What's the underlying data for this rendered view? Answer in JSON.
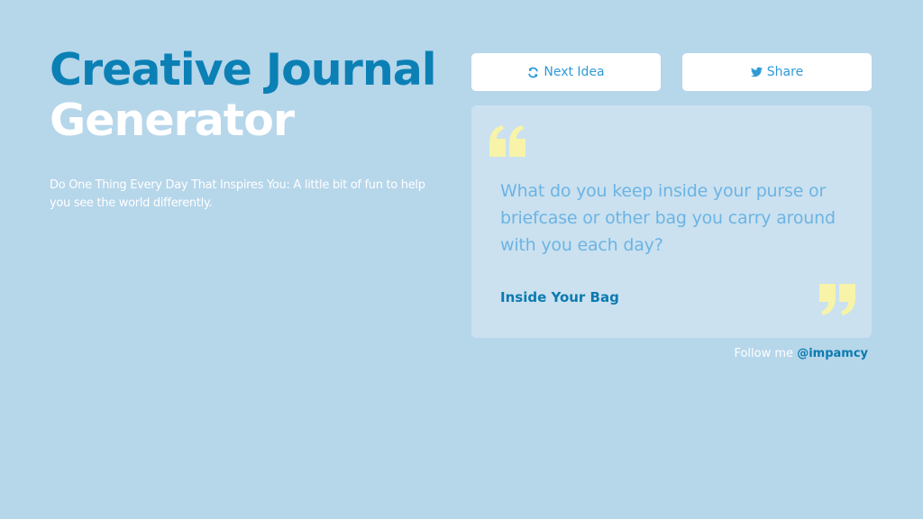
{
  "header": {
    "title_line1": "Creative Journal",
    "title_line2": "Generator",
    "subtitle": "Do One Thing Every Day That Inspires You: A little bit of fun to help you see the world differently."
  },
  "actions": {
    "next_label": "Next Idea",
    "next_icon": "refresh-icon",
    "share_label": "Share",
    "share_icon": "twitter-icon"
  },
  "card": {
    "prompt": "What do you keep inside your purse or briefcase or other bag you carry around with you each day?",
    "prompt_title": "Inside Your Bag",
    "quote_open_icon": "quote-open-icon",
    "quote_close_icon": "quote-close-icon"
  },
  "footer": {
    "follow_text": "Follow me",
    "follow_handle": "@impamcy"
  },
  "colors": {
    "background": "#b6d6ea",
    "accent": "#0b80b5",
    "card": "#cbe1ef",
    "quote_marks": "#f7f3a8",
    "prompt_text": "#6cb4e4",
    "button_text": "#2f9ad6"
  }
}
